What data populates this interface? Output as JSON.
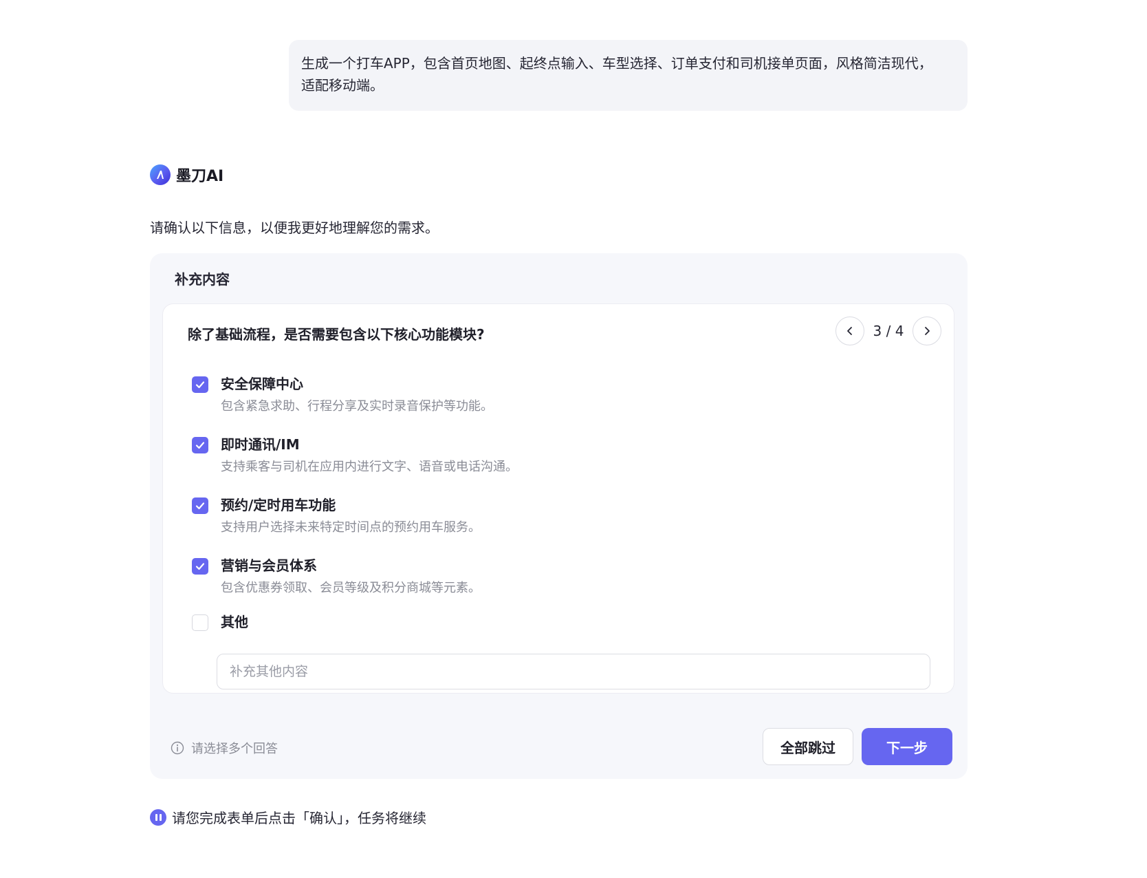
{
  "user_message": "生成一个打车APP，包含首页地图、起终点输入、车型选择、订单支付和司机接单页面，风格简洁现代，适配移动端。",
  "assistant": {
    "name": "墨刀AI",
    "intro": "请确认以下信息，以便我更好地理解您的需求。"
  },
  "form": {
    "title": "补充内容",
    "question": "除了基础流程，是否需要包含以下核心功能模块?",
    "pager": {
      "current": 3,
      "total": 4,
      "label": "3 / 4"
    },
    "options": [
      {
        "title": "安全保障中心",
        "desc": "包含紧急求助、行程分享及实时录音保护等功能。",
        "checked": true
      },
      {
        "title": "即时通讯/IM",
        "desc": "支持乘客与司机在应用内进行文字、语音或电话沟通。",
        "checked": true
      },
      {
        "title": "预约/定时用车功能",
        "desc": "支持用户选择未来特定时间点的预约用车服务。",
        "checked": true
      },
      {
        "title": "营销与会员体系",
        "desc": "包含优惠券领取、会员等级及积分商城等元素。",
        "checked": true
      },
      {
        "title": "其他",
        "desc": "",
        "checked": false
      }
    ],
    "other_input": {
      "placeholder": "补充其他内容",
      "value": ""
    },
    "hint": "请选择多个回答",
    "skip_label": "全部跳过",
    "next_label": "下一步"
  },
  "status_text": "请您完成表单后点击「确认」，任务将继续",
  "colors": {
    "accent": "#6666f0",
    "bubble_bg": "#f3f4f8",
    "card_bg": "#f6f7fb"
  }
}
